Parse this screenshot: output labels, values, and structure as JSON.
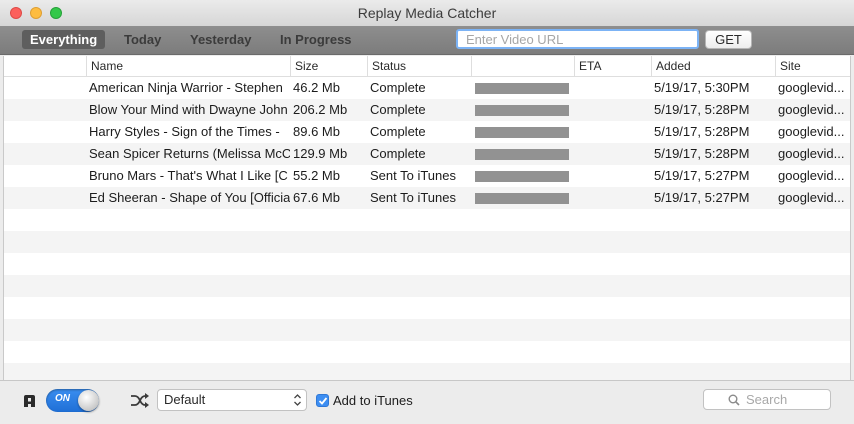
{
  "window": {
    "title": "Replay Media Catcher"
  },
  "toolbar": {
    "tabs": [
      {
        "label": "Everything",
        "active": true
      },
      {
        "label": "Today",
        "active": false
      },
      {
        "label": "Yesterday",
        "active": false
      },
      {
        "label": "In Progress",
        "active": false
      }
    ],
    "url_placeholder": "Enter Video URL",
    "url_value": "",
    "get_label": "GET"
  },
  "table": {
    "columns": [
      "Name",
      "Size",
      "Status",
      "",
      "ETA",
      "Added",
      "Site"
    ],
    "rows": [
      {
        "name": "American Ninja Warrior - Stephen",
        "size": "46.2 Mb",
        "status": "Complete",
        "progress": 1.0,
        "eta": "",
        "added": "5/19/17, 5:30PM",
        "site": "googlevid..."
      },
      {
        "name": "Blow Your Mind with Dwayne John",
        "size": "206.2 Mb",
        "status": "Complete",
        "progress": 1.0,
        "eta": "",
        "added": "5/19/17, 5:28PM",
        "site": "googlevid..."
      },
      {
        "name": "Harry Styles - Sign of the Times -",
        "size": "89.6 Mb",
        "status": "Complete",
        "progress": 1.0,
        "eta": "",
        "added": "5/19/17, 5:28PM",
        "site": "googlevid..."
      },
      {
        "name": "Sean Spicer Returns (Melissa McCa",
        "size": "129.9 Mb",
        "status": "Complete",
        "progress": 1.0,
        "eta": "",
        "added": "5/19/17, 5:28PM",
        "site": "googlevid..."
      },
      {
        "name": "Bruno Mars - That's What I Like [C",
        "size": "55.2 Mb",
        "status": "Sent To iTunes",
        "progress": 1.0,
        "eta": "",
        "added": "5/19/17, 5:27PM",
        "site": "googlevid..."
      },
      {
        "name": "Ed Sheeran - Shape of You [Officia",
        "size": "67.6 Mb",
        "status": "Sent To iTunes",
        "progress": 1.0,
        "eta": "",
        "added": "5/19/17, 5:27PM",
        "site": "googlevid..."
      }
    ]
  },
  "bottom": {
    "toggle_label": "ON",
    "toggle_on": true,
    "preset_value": "Default",
    "add_itunes_label": "Add to iTunes",
    "add_itunes_checked": true,
    "search_placeholder": "Search"
  },
  "colors": {
    "accent": "#3d8ef2",
    "progress": "#929292",
    "toolbar": "#858585"
  }
}
